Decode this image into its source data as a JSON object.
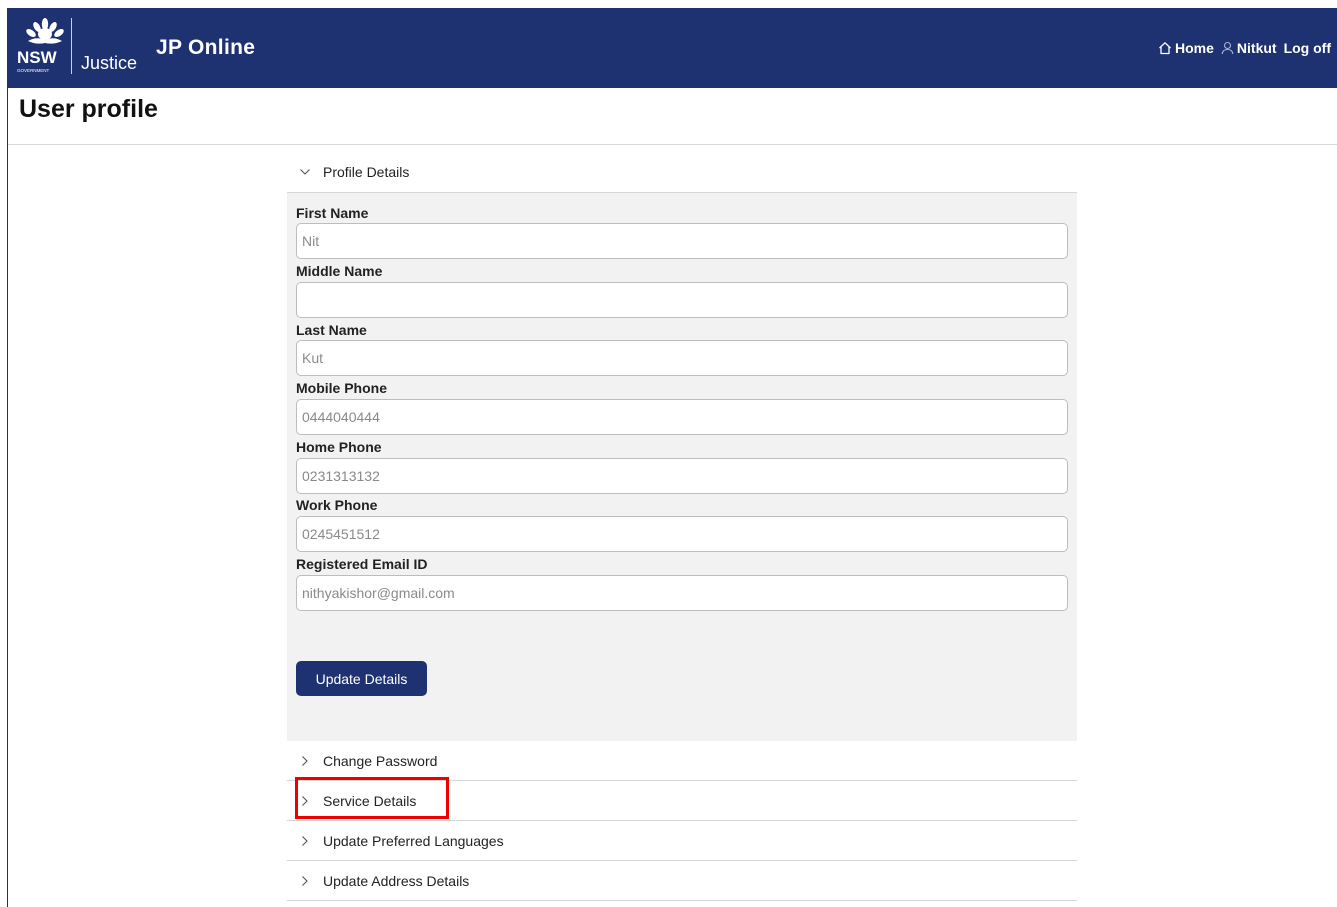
{
  "header": {
    "logo_text": "NSW",
    "logo_subtext": "GOVERNMENT",
    "department": "Justice",
    "app_title": "JP Online",
    "nav": {
      "home_label": "Home",
      "user_label": "Nitkut",
      "logoff_label": "Log off"
    },
    "brand_color": "#1e3170"
  },
  "page": {
    "title": "User profile"
  },
  "profile_details": {
    "section_title": "Profile Details",
    "fields": [
      {
        "label": "First Name",
        "value": "Nit"
      },
      {
        "label": "Middle Name",
        "value": ""
      },
      {
        "label": "Last Name",
        "value": "Kut"
      },
      {
        "label": "Mobile Phone",
        "value": "0444040444"
      },
      {
        "label": "Home Phone",
        "value": "0231313132"
      },
      {
        "label": "Work Phone",
        "value": "0245451512"
      },
      {
        "label": "Registered Email ID",
        "value": "nithyakishor@gmail.com"
      }
    ],
    "update_button": "Update Details"
  },
  "sections": [
    {
      "title": "Change Password"
    },
    {
      "title": "Service Details"
    },
    {
      "title": "Update Preferred Languages"
    },
    {
      "title": "Update Address Details"
    }
  ],
  "highlight_color": "#ee0000"
}
